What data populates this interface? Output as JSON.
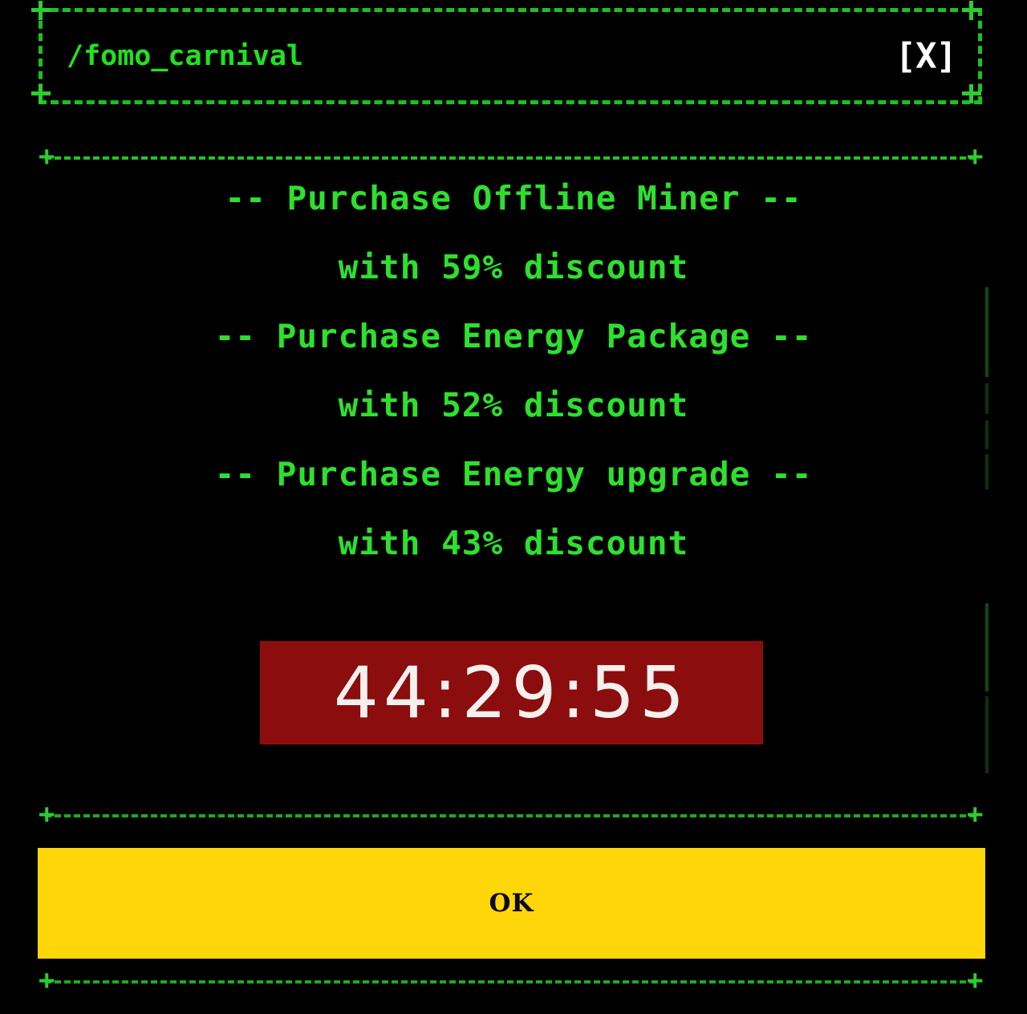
{
  "window": {
    "title": "/fomo_carnival",
    "close_label": "[X]",
    "close_icon": "close-icon"
  },
  "offers": [
    {
      "title": "-- Purchase Offline Miner --",
      "subtitle": "with 59% discount",
      "discount": 59,
      "item": "Offline Miner"
    },
    {
      "title": "-- Purchase Energy Package --",
      "subtitle": "with 52% discount",
      "discount": 52,
      "item": "Energy Package"
    },
    {
      "title": "-- Purchase Energy upgrade --",
      "subtitle": "with 43% discount",
      "discount": 43,
      "item": "Energy upgrade"
    }
  ],
  "countdown": {
    "value": "44:29:55",
    "hours": "44",
    "minutes": "29",
    "seconds": "55"
  },
  "actions": {
    "ok_label": "OK"
  },
  "colors": {
    "background": "#000000",
    "accent_green": "#2ee02e",
    "border_green": "#1fbf1f",
    "countdown_bg": "#8b0d0d",
    "countdown_text": "#f5f0ee",
    "button_yellow": "#ffd60a",
    "button_text": "#0a0a0a",
    "close_text": "#ffffff"
  }
}
